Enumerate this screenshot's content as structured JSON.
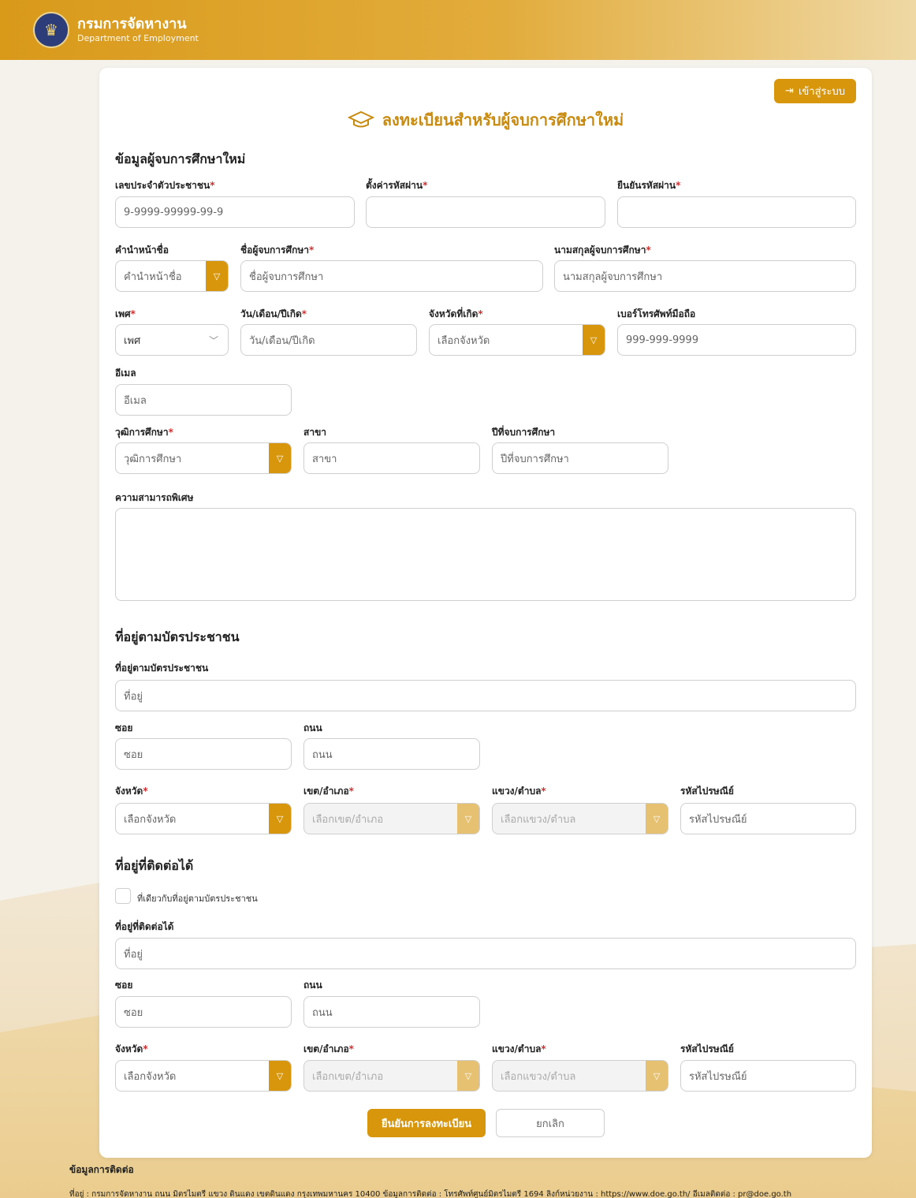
{
  "header": {
    "title_th": "กรมการจัดหางาน",
    "title_en": "Department of Employment",
    "logo_icon": "emblem-icon"
  },
  "login_button": {
    "label": "เข้าสู่ระบบ",
    "icon": "login-icon"
  },
  "page_title": "ลงทะเบียนสำหรับผู้จบการศึกษาใหม่",
  "section1": {
    "title": "ข้อมูลผู้จบการศึกษาใหม่",
    "id_label": "เลขประจำตัวประชาชน",
    "id_placeholder": "9-9999-99999-99-9",
    "pw_label": "ตั้งค่ารหัสผ่าน",
    "pw_confirm_label": "ยืนยันรหัสผ่าน",
    "prefix_label": "คำนำหน้าชื่อ",
    "prefix_placeholder": "คำนำหน้าชื่อ",
    "fname_label": "ชื่อผู้จบการศึกษา",
    "fname_placeholder": "ชื่อผู้จบการศึกษา",
    "lname_label": "นามสกุลผู้จบการศึกษา",
    "lname_placeholder": "นามสกุลผู้จบการศึกษา",
    "gender_label": "เพศ",
    "gender_value": "เพศ",
    "dob_label": "วัน/เดือน/ปีเกิด",
    "dob_placeholder": "วัน/เดือน/ปีเกิด",
    "birth_prov_label": "จังหวัดที่เกิด",
    "birth_prov_placeholder": "เลือกจังหวัด",
    "mobile_label": "เบอร์โทรศัพท์มือถือ",
    "mobile_placeholder": "999-999-9999",
    "email_label": "อีเมล",
    "email_placeholder": "อีเมล",
    "edu_label": "วุฒิการศึกษา",
    "edu_placeholder": "วุฒิการศึกษา",
    "major_label": "สาขา",
    "major_placeholder": "สาขา",
    "grad_year_label": "ปีที่จบการศึกษา",
    "grad_year_placeholder": "ปีที่จบการศึกษา",
    "skill_label": "ความสามารถพิเศษ"
  },
  "section2": {
    "title": "ที่อยู่ตามบัตรประชาชน",
    "addr_label": "ที่อยู่ตามบัตรประชาชน",
    "addr_placeholder": "ที่อยู่",
    "soi_label": "ซอย",
    "soi_placeholder": "ซอย",
    "road_label": "ถนน",
    "road_placeholder": "ถนน",
    "prov_label": "จังหวัด",
    "prov_placeholder": "เลือกจังหวัด",
    "dist_label": "เขต/อำเภอ",
    "dist_placeholder": "เลือกเขต/อำเภอ",
    "sub_label": "แขวง/ตำบล",
    "sub_placeholder": "เลือกแขวง/ตำบล",
    "zip_label": "รหัสไปรษณีย์",
    "zip_placeholder": "รหัสไปรษณีย์"
  },
  "section3": {
    "title": "ที่อยู่ที่ติดต่อได้",
    "same_label": "ที่เดียวกับที่อยู่ตามบัตรประชาชน",
    "addr_label": "ที่อยู่ที่ติดต่อได้",
    "addr_placeholder": "ที่อยู่",
    "soi_label": "ซอย",
    "soi_placeholder": "ซอย",
    "road_label": "ถนน",
    "road_placeholder": "ถนน",
    "prov_label": "จังหวัด",
    "prov_placeholder": "เลือกจังหวัด",
    "dist_label": "เขต/อำเภอ",
    "dist_placeholder": "เลือกเขต/อำเภอ",
    "sub_label": "แขวง/ตำบล",
    "sub_placeholder": "เลือกแขวง/ตำบล",
    "zip_label": "รหัสไปรษณีย์",
    "zip_placeholder": "รหัสไปรษณีย์"
  },
  "buttons": {
    "submit": "ยืนยันการลงทะเบียน",
    "cancel": "ยกเลิก"
  },
  "footer": {
    "title": "ข้อมูลการติดต่อ",
    "address": "ที่อยู่ : กรมการจัดหางาน ถนน มิตรไมตรี แขวง ดินแดง เขตดินแดง กรุงเทพมหานคร 10400 ข้อมูลการติดต่อ : โทรศัพท์ศูนย์มิตรไมตรี 1694 ลิงก์หน่วยงาน : https://www.doe.go.th/ อีเมลติดต่อ : pr@doe.go.th"
  },
  "required_mark": "*",
  "colors": {
    "accent": "#d8960d",
    "title": "#c98a10",
    "required": "#d32f2f"
  }
}
